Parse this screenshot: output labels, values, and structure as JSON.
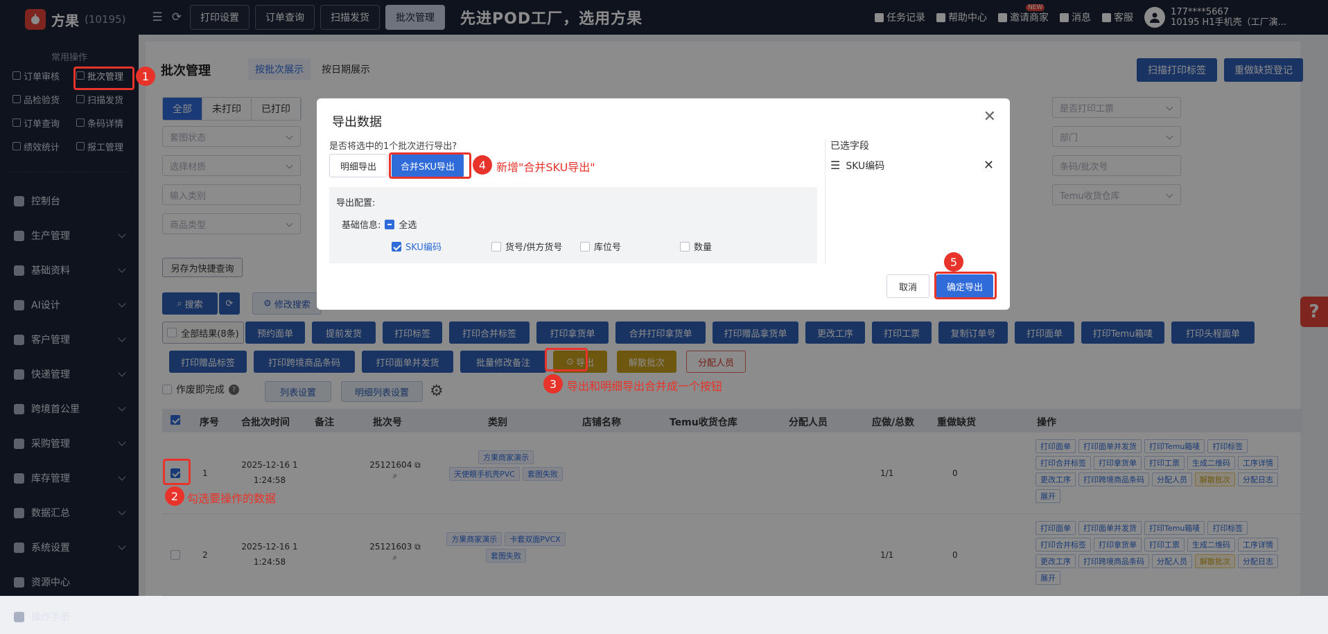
{
  "app": {
    "name": "方果",
    "count": "(10195)"
  },
  "sidebar": {
    "common_title": "常用操作",
    "quick": [
      {
        "label": "订单审核"
      },
      {
        "label": "批次管理"
      },
      {
        "label": "品检验货"
      },
      {
        "label": "扫描发货"
      },
      {
        "label": "订单查询"
      },
      {
        "label": "条码详情"
      },
      {
        "label": "绩效统计"
      },
      {
        "label": "报工管理"
      }
    ],
    "menu": [
      {
        "label": "控制台",
        "icon": "dashboard-icon"
      },
      {
        "label": "生产管理",
        "icon": "production-icon"
      },
      {
        "label": "基础资料",
        "icon": "database-icon"
      },
      {
        "label": "AI设计",
        "icon": "ai-icon"
      },
      {
        "label": "客户管理",
        "icon": "customer-icon"
      },
      {
        "label": "快递管理",
        "icon": "express-icon"
      },
      {
        "label": "跨境首公里",
        "icon": "globe-icon"
      },
      {
        "label": "采购管理",
        "icon": "purchase-icon"
      },
      {
        "label": "库存管理",
        "icon": "inventory-icon"
      },
      {
        "label": "数据汇总",
        "icon": "pie-chart-icon"
      },
      {
        "label": "系统设置",
        "icon": "settings-icon"
      },
      {
        "label": "资源中心",
        "icon": "resource-icon"
      },
      {
        "label": "操作手册",
        "icon": "manual-icon"
      }
    ]
  },
  "header": {
    "tabs": [
      "打印设置",
      "订单查询",
      "扫描发货",
      "批次管理"
    ],
    "slogan": "先进POD工厂，选用方果",
    "links": [
      "任务记录",
      "帮助中心",
      "邀请商家",
      "消息",
      "客服"
    ],
    "new_badge": "NEW",
    "user_line1": "177****5667",
    "user_line2": "10195  H1手机壳（工厂演..."
  },
  "page": {
    "title": "批次管理",
    "tabs": [
      "按批次展示",
      "按日期展示"
    ],
    "right_buttons": [
      "扫描打印标签",
      "重做缺货登记"
    ],
    "filter_seg": [
      "全部",
      "未打印",
      "已打印"
    ],
    "fields": [
      "套图状态",
      "选择材质",
      "输入类别",
      "商品类型",
      "是否打印工票",
      "部门",
      "条码/批次号",
      "Temu收货仓库"
    ],
    "save_query": "另存为快捷查询",
    "search": "搜索",
    "modify_search": "修改搜索",
    "all_results": "全部结果(8条)",
    "actions_row1": [
      "预约面单",
      "提前发货",
      "打印标签",
      "打印合并标签",
      "打印拿货单",
      "合并打印拿货单",
      "打印赠品拿货单",
      "更改工序",
      "打印工票",
      "复制订单号",
      "打印面单",
      "打印Temu箱唛",
      "打印头程面单"
    ],
    "actions_row2": [
      "打印赠品标签",
      "打印跨境商品条码",
      "打印面单并发货",
      "批量修改备注"
    ],
    "export_btn": "导出",
    "dissolve_btn": "解散批次",
    "assign_btn": "分配人员",
    "void_done": "作废即完成",
    "list_settings": "列表设置",
    "detail_list_settings": "明细列表设置"
  },
  "table": {
    "headers": [
      "序号",
      "合批次时间",
      "备注",
      "批次号",
      "类别",
      "店铺名称",
      "Temu收货仓库",
      "分配人员",
      "应做/总数",
      "重做缺货",
      "操作"
    ],
    "rows": [
      {
        "no": "1",
        "time1": "2025-12-16 1",
        "time2": "1:24:58",
        "batch": "25121604",
        "tags": [
          "方果商家演示",
          "天使眼手机壳PVC",
          "套图失败"
        ],
        "count": "1/1",
        "redo": "0",
        "checked": true,
        "ops": [
          "打印面单",
          "打印面单并发货",
          "打印Temu箱唛",
          "打印标签",
          "打印合并标签",
          "打印拿货单",
          "打印工票",
          "生成二维码",
          "工序详情",
          "更改工序",
          "打印跨境商品条码",
          "分配人员",
          "解散批次",
          "分配日志",
          "展开"
        ]
      },
      {
        "no": "2",
        "time1": "2025-12-16 1",
        "time2": "1:24:58",
        "batch": "25121603",
        "tags": [
          "方果商家演示",
          "卡套双面PVCX",
          "套图失败"
        ],
        "count": "1/1",
        "redo": "0",
        "checked": false,
        "ops": [
          "打印面单",
          "打印面单并发货",
          "打印Temu箱唛",
          "打印标签",
          "打印合并标签",
          "打印拿货单",
          "打印工票",
          "生成二维码",
          "工序详情",
          "更改工序",
          "打印跨境商品条码",
          "分配人员",
          "解散批次",
          "分配日志",
          "展开"
        ]
      }
    ]
  },
  "modal": {
    "title": "导出数据",
    "question": "是否将选中的1个批次进行导出?",
    "opt_detail": "明细导出",
    "opt_merge": "合并SKU导出",
    "config_title": "导出配置:",
    "basic_info": "基础信息:",
    "select_all": "全选",
    "fields": [
      "SKU编码",
      "货号/供方货号",
      "库位号",
      "数量"
    ],
    "selected_title": "已选字段",
    "selected_items": [
      "SKU编码"
    ],
    "cancel": "取消",
    "confirm": "确定导出"
  },
  "annotations": {
    "n1": "1",
    "n2": "2",
    "n3": "3",
    "n4": "4",
    "n5": "5",
    "note2": "勾选要操作的数据",
    "note3": "导出和明细导出合并成一个按钮",
    "note4": "新增\"合并SKU导出\""
  },
  "colors": {
    "accent": "#2f6bd9",
    "sidebar": "#1d2438",
    "annotation": "#e8332a"
  }
}
